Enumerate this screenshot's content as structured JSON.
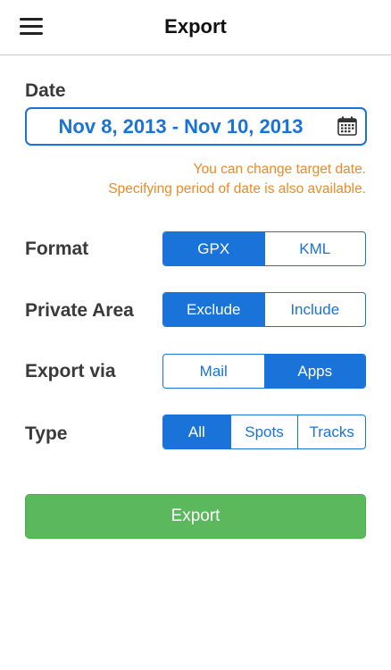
{
  "header": {
    "title": "Export",
    "menu_icon": "hamburger-menu-icon"
  },
  "date": {
    "label": "Date",
    "value": "Nov 8, 2013 - Nov 10, 2013",
    "icon": "calendar-icon",
    "hint_line1": "You can change target date.",
    "hint_line2": "Specifying period of date is also available."
  },
  "format": {
    "label": "Format",
    "options": [
      "GPX",
      "KML"
    ],
    "selected": "GPX"
  },
  "private_area": {
    "label": "Private Area",
    "options": [
      "Exclude",
      "Include"
    ],
    "selected": "Exclude"
  },
  "export_via": {
    "label": "Export via",
    "options": [
      "Mail",
      "Apps"
    ],
    "selected": "Apps"
  },
  "type": {
    "label": "Type",
    "options": [
      "All",
      "Spots",
      "Tracks"
    ],
    "selected": "All"
  },
  "export_button": {
    "label": "Export"
  },
  "colors": {
    "accent": "#1a73d9",
    "hint": "#f08a24",
    "button": "#5cb85c"
  }
}
